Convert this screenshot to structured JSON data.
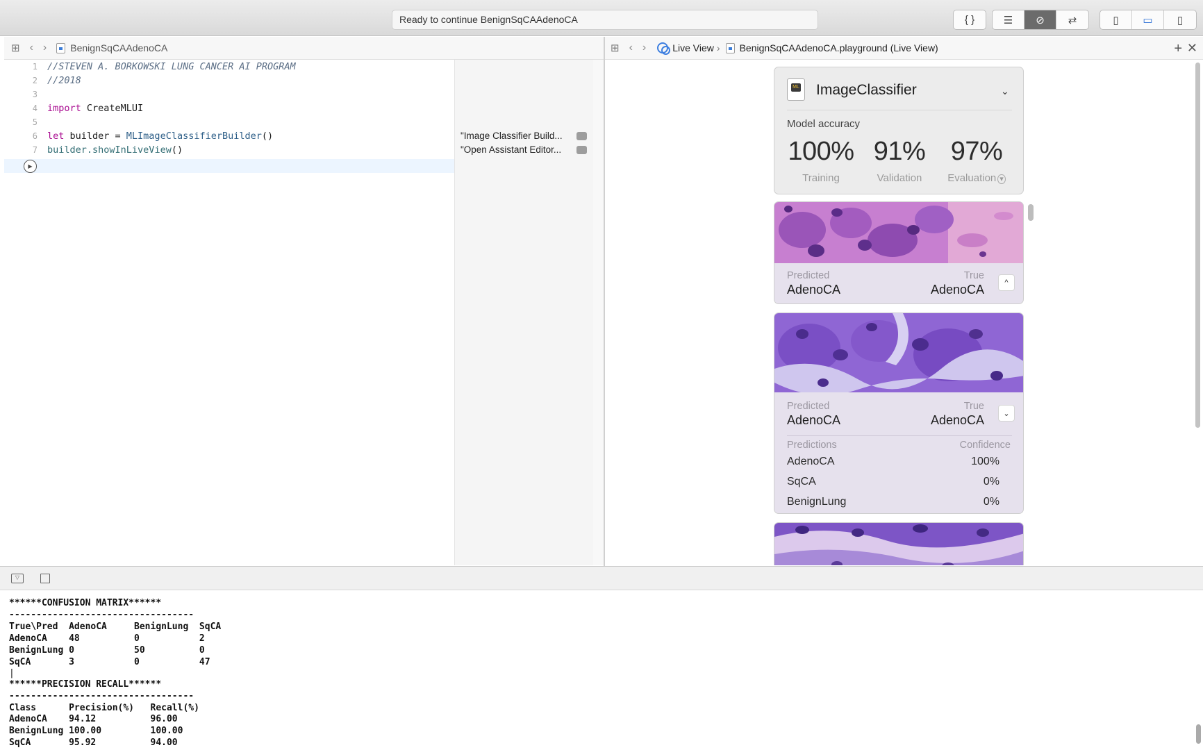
{
  "toolbar": {
    "status_text": "Ready to continue BenignSqCAAdenoCA",
    "icons": [
      "braces-icon",
      "standard-editor-icon",
      "assistant-editor-icon",
      "version-editor-icon",
      "navigator-icon",
      "debug-area-icon",
      "inspector-icon"
    ]
  },
  "editor": {
    "jumpbar_file": "BenignSqCAAdenoCA",
    "lines": [
      {
        "n": "1",
        "text": "//STEVEN A. BORKOWSKI LUNG CANCER AI PROGRAM"
      },
      {
        "n": "2",
        "text": "//2018"
      },
      {
        "n": "3",
        "text": ""
      },
      {
        "n": "4",
        "kw": "import",
        "rest": " CreateMLUI"
      },
      {
        "n": "5",
        "text": ""
      },
      {
        "n": "6",
        "kw": "let",
        "rest": " builder = ",
        "type": "MLImageClassifierBuilder",
        "tail": "()"
      },
      {
        "n": "7",
        "obj": "builder",
        "call": ".showInLiveView",
        "tail": "()"
      }
    ],
    "results": [
      "\"Image Classifier Build...",
      "\"Open Assistant Editor..."
    ]
  },
  "live_view": {
    "breadcrumb_root": "Live View",
    "breadcrumb_file": "BenignSqCAAdenoCA.playground (Live View)",
    "classifier": {
      "title": "ImageClassifier",
      "accuracy_label": "Model accuracy",
      "metrics": [
        {
          "value": "100%",
          "label": "Training"
        },
        {
          "value": "91%",
          "label": "Validation"
        },
        {
          "value": "97%",
          "label": "Evaluation"
        }
      ]
    },
    "predicted_label": "Predicted",
    "true_label": "True",
    "cards": [
      {
        "predicted": "AdenoCA",
        "true": "AdenoCA"
      },
      {
        "predicted": "AdenoCA",
        "true": "AdenoCA",
        "predictions_header": "Predictions",
        "confidence_header": "Confidence",
        "predictions": [
          {
            "class": "AdenoCA",
            "confidence": "100%"
          },
          {
            "class": "SqCA",
            "confidence": "0%"
          },
          {
            "class": "BenignLung",
            "confidence": "0%"
          }
        ]
      }
    ]
  },
  "console": {
    "lines": [
      "******CONFUSION MATRIX******",
      "----------------------------------",
      "True\\Pred  AdenoCA     BenignLung  SqCA",
      "AdenoCA    48          0           2",
      "BenignLung 0           50          0",
      "SqCA       3           0           47",
      "|",
      "******PRECISION RECALL******",
      "----------------------------------",
      "Class      Precision(%)   Recall(%)",
      "AdenoCA    94.12          96.00",
      "BenignLung 100.00         100.00",
      "SqCA       95.92          94.00"
    ]
  }
}
